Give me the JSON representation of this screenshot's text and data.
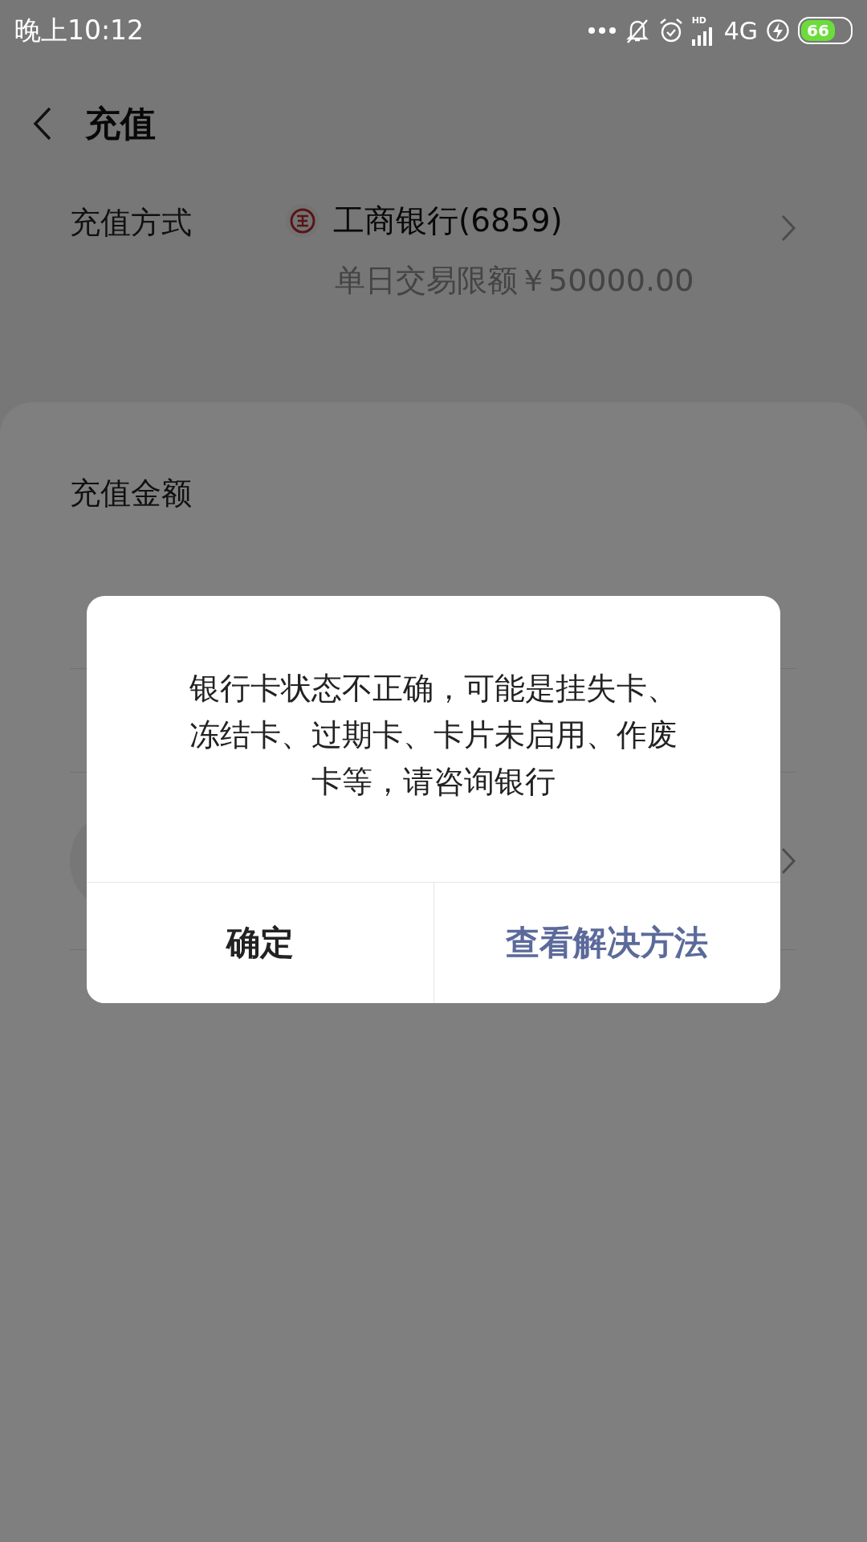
{
  "status_bar": {
    "time": "晚上10:12",
    "hd": "HD",
    "network": "4G",
    "battery": "66"
  },
  "header": {
    "title": "充值"
  },
  "payment": {
    "label": "充值方式",
    "bank": "工商银行(6859)",
    "limit": "单日交易限额￥50000.00"
  },
  "amount": {
    "label": "充值金额"
  },
  "dialog": {
    "message": "银行卡状态不正确，可能是挂失卡、冻结卡、过期卡、卡片未启用、作废卡等，请咨询银行",
    "buttons": [
      {
        "label": "确定",
        "kind": "plain"
      },
      {
        "label": "查看解决方法",
        "kind": "accent"
      }
    ]
  }
}
